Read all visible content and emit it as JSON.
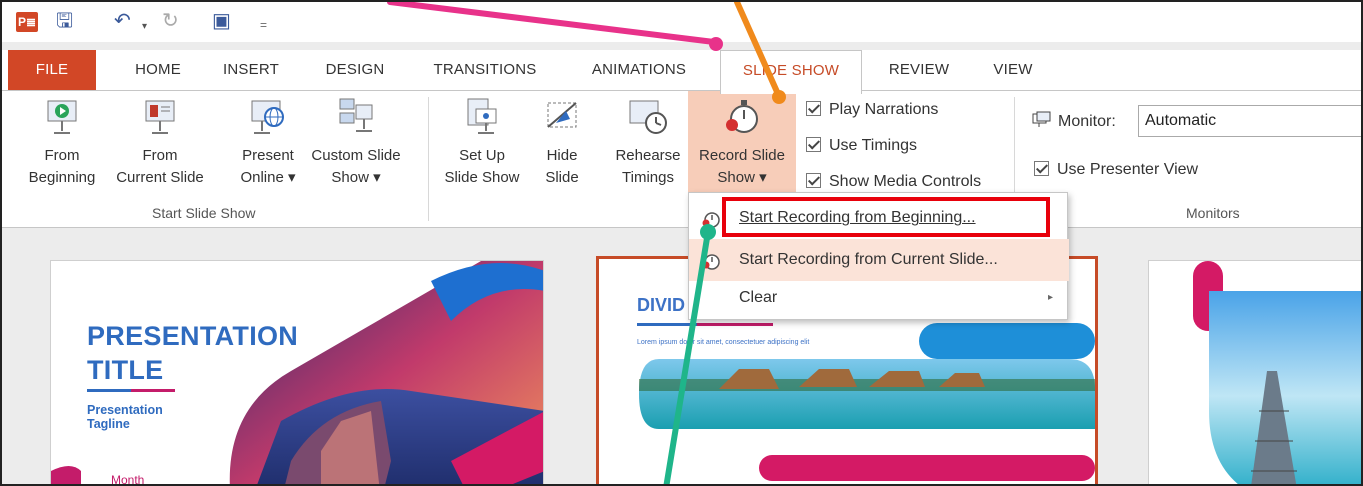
{
  "qat": {
    "app_icon_label": "P≣",
    "undo_dropdown": "▾",
    "customize": "="
  },
  "tabs": [
    "FILE",
    "HOME",
    "INSERT",
    "DESIGN",
    "TRANSITIONS",
    "ANIMATIONS",
    "SLIDE SHOW",
    "REVIEW",
    "VIEW"
  ],
  "ribbon": {
    "start_group": {
      "label": "Start Slide Show",
      "buttons": [
        {
          "line1": "From",
          "line2": "Beginning"
        },
        {
          "line1": "From",
          "line2": "Current Slide"
        },
        {
          "line1": "Present",
          "line2": "Online ▾"
        },
        {
          "line1": "Custom Slide",
          "line2": "Show ▾"
        }
      ]
    },
    "setup_group": {
      "buttons": [
        {
          "line1": "Set Up",
          "line2": "Slide Show"
        },
        {
          "line1": "Hide",
          "line2": "Slide"
        },
        {
          "line1": "Rehearse",
          "line2": "Timings"
        },
        {
          "line1": "Record Slide",
          "line2": "Show ▾"
        }
      ],
      "checkboxes": [
        "Play Narrations",
        "Use Timings",
        "Show Media Controls"
      ]
    },
    "monitors_group": {
      "label": "Monitors",
      "monitor_label": "Monitor:",
      "monitor_value": "Automatic",
      "presenter_view": "Use Presenter View"
    }
  },
  "dropdown": {
    "items": [
      {
        "label": "Start Recording from Beginning...",
        "has_submenu": false
      },
      {
        "label": "Start Recording from Current Slide...",
        "has_submenu": false
      },
      {
        "label": "Clear",
        "has_submenu": true
      }
    ],
    "submenu_arrow": "▸"
  },
  "slides": {
    "slide1": {
      "title_line1": "PRESENTATION",
      "title_line2": "TITLE",
      "tagline_line1": "Presentation",
      "tagline_line2": "Tagline",
      "month": "Month"
    },
    "slide2": {
      "title": "DIVID",
      "lorem": "Lorem ipsum dolor sit amet, consectetuer adipiscing elit"
    }
  },
  "colors": {
    "accent": "#d24726",
    "tab_active_text": "#c64b27",
    "record_highlight": "#f7cdb9",
    "annotation_pink": "#e8328a",
    "annotation_orange": "#f08a1c",
    "annotation_green": "#1fb58a",
    "red_box": "#e8000b"
  }
}
